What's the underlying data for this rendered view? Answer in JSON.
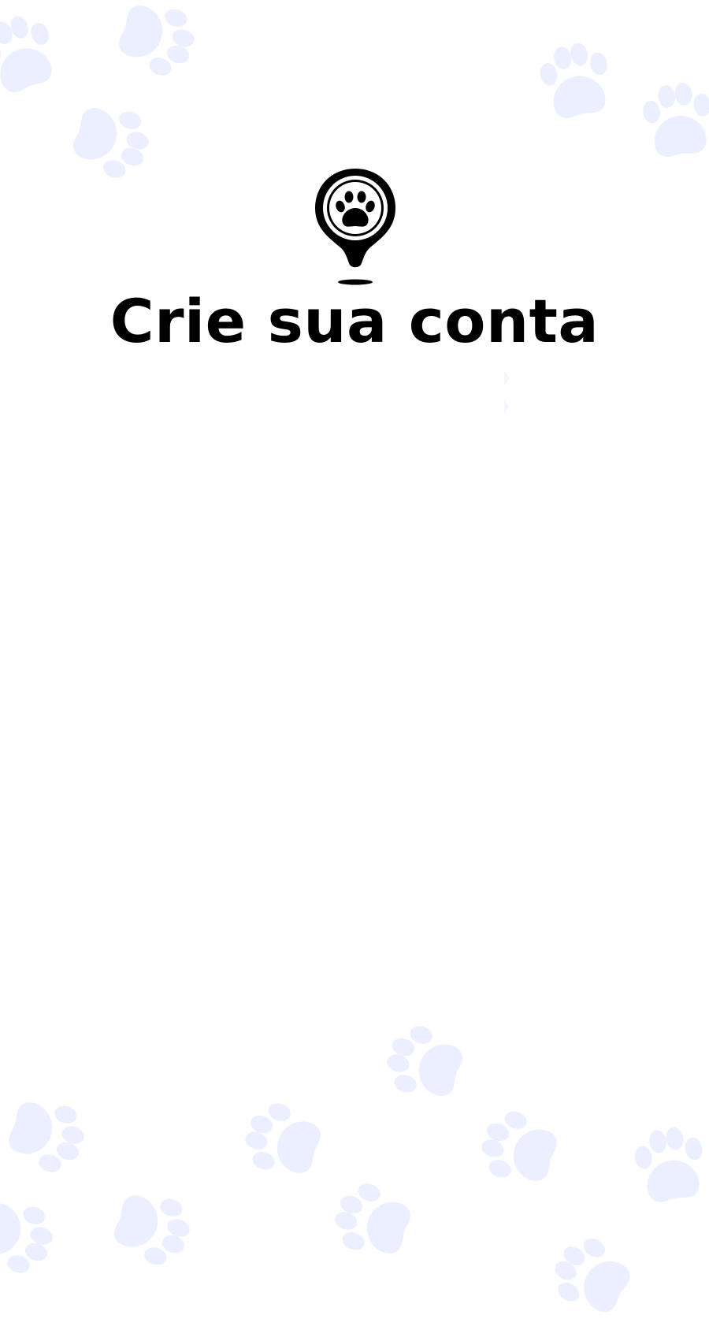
{
  "screen": {
    "title": "Crie sua conta"
  },
  "brand": {
    "logo_icon": "paw-location-pin-icon",
    "logo_color": "#000000"
  },
  "background": {
    "pattern_icon": "paw-print-icon",
    "pattern_color": "#ebefff",
    "page_color": "#ffffff"
  }
}
